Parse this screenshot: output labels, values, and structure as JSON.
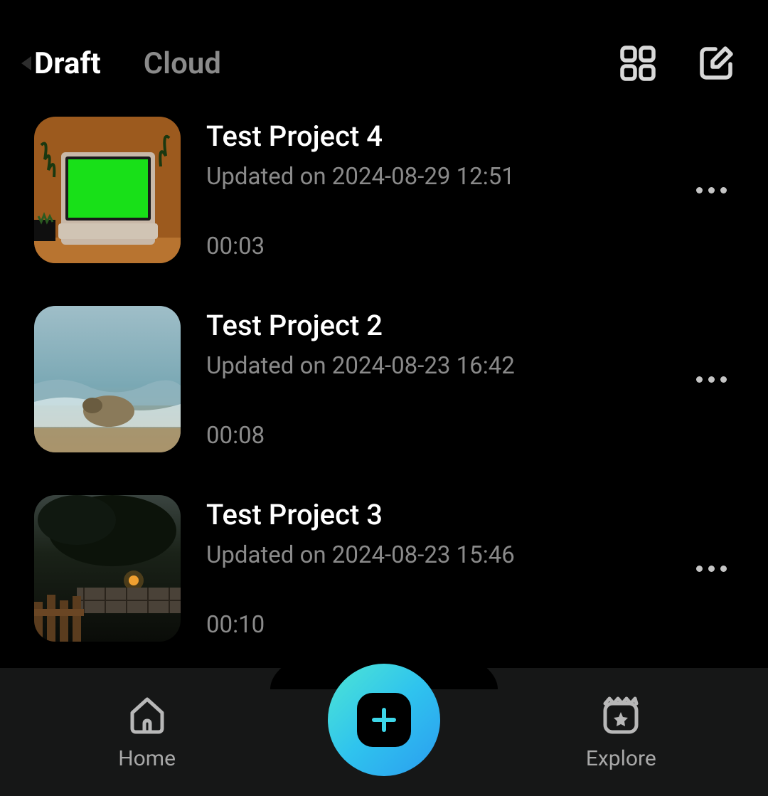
{
  "tabs": {
    "draft": "Draft",
    "cloud": "Cloud"
  },
  "projects": [
    {
      "title": "Test Project 4",
      "updated": "Updated on 2024-08-29 12:51",
      "duration": "00:03"
    },
    {
      "title": "Test Project 2",
      "updated": "Updated on 2024-08-23 16:42",
      "duration": "00:08"
    },
    {
      "title": "Test Project 3",
      "updated": "Updated on 2024-08-23 15:46",
      "duration": "00:10"
    }
  ],
  "nav": {
    "home": "Home",
    "explore": "Explore"
  }
}
